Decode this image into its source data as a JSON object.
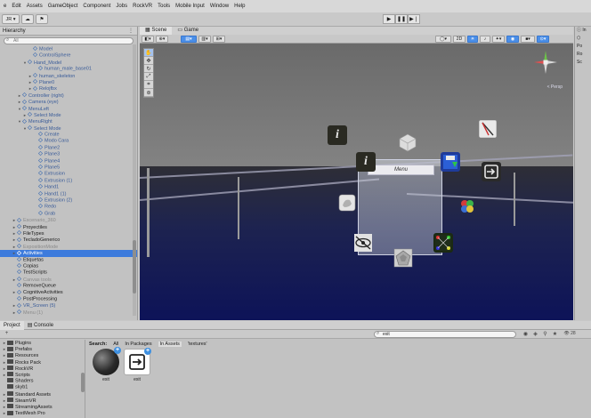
{
  "menubar": {
    "items": [
      "e",
      "Edit",
      "Assets",
      "GameObject",
      "Component",
      "Jobs",
      "RockVR",
      "Tools",
      "Mobile Input",
      "Window",
      "Help"
    ]
  },
  "toolbar": {
    "account_label": "JR ▾",
    "cloud_icon": "cloud-icon",
    "collab_icon": "collab-icon",
    "play_icon": "play-icon",
    "pause_icon": "pause-icon",
    "step_icon": "step-icon"
  },
  "hierarchy": {
    "title": "Hierarchy",
    "search_placeholder": "All",
    "items": [
      {
        "label": "Model",
        "indent": 5,
        "style": "blue",
        "arrow": ""
      },
      {
        "label": "ControlSphere",
        "indent": 5,
        "style": "blue",
        "arrow": ""
      },
      {
        "label": "Hand_Model",
        "indent": 4,
        "style": "blue",
        "arrow": "▼"
      },
      {
        "label": "human_male_base01",
        "indent": 6,
        "style": "blue",
        "arrow": ""
      },
      {
        "label": "human_skeleton",
        "indent": 5,
        "style": "blue",
        "arrow": "►"
      },
      {
        "label": "Plane0",
        "indent": 5,
        "style": "blue",
        "arrow": "►"
      },
      {
        "label": "Relojfbx",
        "indent": 5,
        "style": "blue",
        "arrow": "►"
      },
      {
        "label": "Controller (right)",
        "indent": 3,
        "style": "blue",
        "arrow": "►"
      },
      {
        "label": "Camera (eye)",
        "indent": 3,
        "style": "blue",
        "arrow": "►"
      },
      {
        "label": "MenuLeft",
        "indent": 3,
        "style": "blue",
        "arrow": "▼"
      },
      {
        "label": "Select Mode",
        "indent": 4,
        "style": "blue",
        "arrow": "►"
      },
      {
        "label": "MenuRight",
        "indent": 3,
        "style": "blue",
        "arrow": "▼"
      },
      {
        "label": "Select Mode",
        "indent": 4,
        "style": "blue",
        "arrow": "▼"
      },
      {
        "label": "Create",
        "indent": 6,
        "style": "blue",
        "arrow": ""
      },
      {
        "label": "Modo Cara",
        "indent": 6,
        "style": "blue",
        "arrow": ""
      },
      {
        "label": "Plane2",
        "indent": 6,
        "style": "blue",
        "arrow": ""
      },
      {
        "label": "Plane3",
        "indent": 6,
        "style": "blue",
        "arrow": ""
      },
      {
        "label": "Plane4",
        "indent": 6,
        "style": "blue",
        "arrow": ""
      },
      {
        "label": "Plane5",
        "indent": 6,
        "style": "blue",
        "arrow": ""
      },
      {
        "label": "Extrusion",
        "indent": 6,
        "style": "blue",
        "arrow": ""
      },
      {
        "label": "Extrusion (1)",
        "indent": 6,
        "style": "blue",
        "arrow": ""
      },
      {
        "label": "Hand1",
        "indent": 6,
        "style": "blue",
        "arrow": ""
      },
      {
        "label": "Hand1 (1)",
        "indent": 6,
        "style": "blue",
        "arrow": ""
      },
      {
        "label": "Extrusion (2)",
        "indent": 6,
        "style": "blue",
        "arrow": ""
      },
      {
        "label": "Redo",
        "indent": 6,
        "style": "blue",
        "arrow": ""
      },
      {
        "label": "Grab",
        "indent": 6,
        "style": "blue",
        "arrow": ""
      },
      {
        "label": "Escenario_360",
        "indent": 2,
        "style": "gray",
        "arrow": "►"
      },
      {
        "label": "Proyectiles",
        "indent": 2,
        "style": "normal",
        "arrow": "►"
      },
      {
        "label": "FileTypes",
        "indent": 2,
        "style": "normal",
        "arrow": "►"
      },
      {
        "label": "TecladoGenerico",
        "indent": 2,
        "style": "normal",
        "arrow": "►"
      },
      {
        "label": "ExpositionMode",
        "indent": 2,
        "style": "gray",
        "arrow": "►"
      },
      {
        "label": "Activities",
        "indent": 2,
        "style": "sel",
        "arrow": "►"
      },
      {
        "label": "Etiquetas",
        "indent": 2,
        "style": "normal",
        "arrow": ""
      },
      {
        "label": "Copias",
        "indent": 2,
        "style": "normal",
        "arrow": ""
      },
      {
        "label": "TestScripts",
        "indent": 2,
        "style": "normal",
        "arrow": ""
      },
      {
        "label": "Canvas tools",
        "indent": 2,
        "style": "gray",
        "arrow": "►"
      },
      {
        "label": "RemoveQueue",
        "indent": 2,
        "style": "normal",
        "arrow": ""
      },
      {
        "label": "CognitiveActivities",
        "indent": 2,
        "style": "normal",
        "arrow": "►"
      },
      {
        "label": "PostProcessing",
        "indent": 2,
        "style": "normal",
        "arrow": ""
      },
      {
        "label": "VR_Screen (5)",
        "indent": 2,
        "style": "blue",
        "arrow": "►"
      },
      {
        "label": "Menu (1)",
        "indent": 2,
        "style": "gray",
        "arrow": "►"
      }
    ]
  },
  "scene": {
    "tabs": [
      "Scene",
      "Game"
    ],
    "toolbar": {
      "twod_label": "2D",
      "persp_label": "< Persp"
    },
    "menu_title": "Menu"
  },
  "inspector": {
    "title": "In",
    "rows": [
      "Po",
      "Ro",
      "Sc"
    ]
  },
  "project": {
    "tabs": [
      "Project",
      "Console"
    ],
    "search_value": "exit",
    "filter_count": "28",
    "search_label": "Search:",
    "filters": [
      "All",
      "In Packages",
      "In Assets",
      "'textures'"
    ],
    "folders": [
      {
        "label": "Plugins",
        "arrow": "►"
      },
      {
        "label": "Prefabs",
        "arrow": "►"
      },
      {
        "label": "Resources",
        "arrow": "►"
      },
      {
        "label": "Rocks Pack",
        "arrow": "►"
      },
      {
        "label": "RockVR",
        "arrow": "►"
      },
      {
        "label": "Scripts",
        "arrow": "►"
      },
      {
        "label": "Shaders",
        "arrow": ""
      },
      {
        "label": "skyb1",
        "arrow": ""
      },
      {
        "label": "Standard Assets",
        "arrow": "►"
      },
      {
        "label": "SteamVR",
        "arrow": "►"
      },
      {
        "label": "StreamingAssets",
        "arrow": "►"
      },
      {
        "label": "TextMesh Pro",
        "arrow": "►"
      }
    ],
    "assets": [
      {
        "label": "exit",
        "kind": "sphere"
      },
      {
        "label": "exit",
        "kind": "exit"
      }
    ]
  },
  "colors": {
    "selection": "#3d7bdc",
    "scene_ground": "#0d1358",
    "accent_blue": "#3d8fe0"
  }
}
